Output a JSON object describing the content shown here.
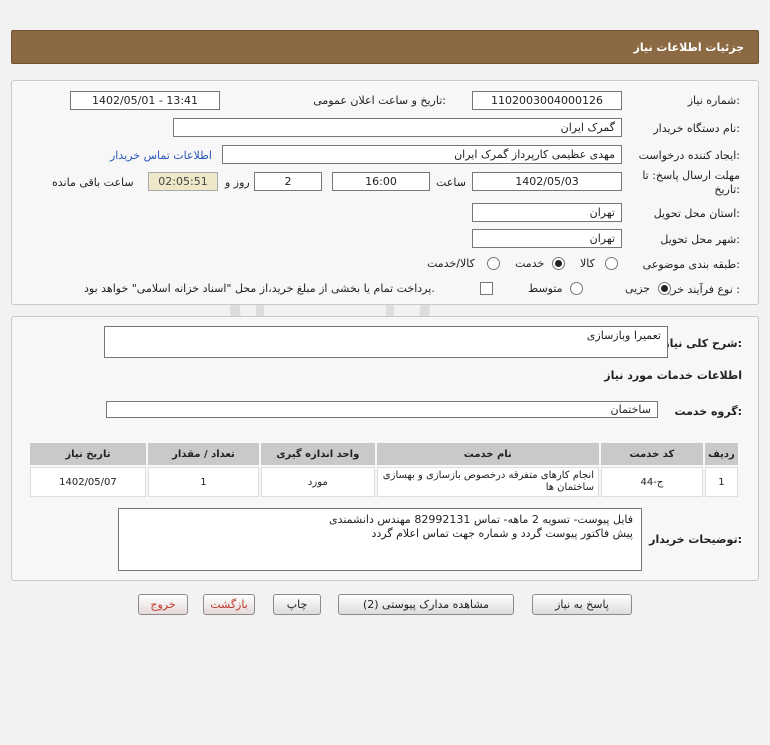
{
  "header": {
    "title": "جزئیات اطلاعات نیاز"
  },
  "form": {
    "need_number_label": "شماره نیاز:",
    "need_number": "1102003004000126",
    "announce_label": "تاریخ و ساعت اعلان عمومی:",
    "announce_value": "1402/05/01 - 13:41",
    "buyer_org_label": "نام دستگاه خریدار:",
    "buyer_org": "گمرک ایران",
    "creator_label": "ایجاد کننده درخواست:",
    "creator": "مهدی عظیمی کارپرداز گمرک ایران",
    "contact_link": "اطلاعات تماس خریدار",
    "deadline_label": "مهلت ارسال پاسخ: تا",
    "deadline_label2": "تاریخ:",
    "deadline_date": "1402/05/03",
    "time_label": "ساعت",
    "deadline_time": "16:00",
    "days_value": "2",
    "days_label": "روز و",
    "remaining_time": "02:05:51",
    "remaining_label": "ساعت باقی مانده",
    "province_label": "استان محل تحویل:",
    "province": "تهران",
    "city_label": "شهر محل تحویل:",
    "city": "تهران",
    "category_label": "طبقه بندی موضوعی:",
    "category_options": [
      "کالا",
      "خدمت",
      "کالا/خدمت"
    ],
    "category_selected": "خدمت",
    "process_label": "نوع فرآیند خرید :",
    "process_options": [
      "جزیی",
      "متوسط"
    ],
    "process_selected": "جزیی",
    "payment_note": "پرداخت تمام یا بخشی از مبلغ خرید،از محل \"اسناد خزانه اسلامی\" خواهد بود."
  },
  "summary": {
    "label": "شرح کلی نیاز:",
    "value": "تعمیرا وبازسازی"
  },
  "services": {
    "section_title": "اطلاعات خدمات مورد نیاز",
    "group_label": "گروه خدمت:",
    "group_value": "ساختمان",
    "columns": [
      "ردیف",
      "کد خدمت",
      "نام خدمت",
      "واحد اندازه گیری",
      "تعداد / مقدار",
      "تاریخ نیاز"
    ],
    "rows": [
      {
        "row": "1",
        "code": "ج-44",
        "name": "انجام کارهای متفرقه درخصوص بازسازی و بهسازی ساختمان ها",
        "unit": "مورد",
        "qty": "1",
        "date": "1402/05/07"
      }
    ]
  },
  "buyer_notes": {
    "label": "توضیحات خریدار:",
    "line1": "فایل پیوست- تسویه 2 ماهه- تماس 82992131 مهندس دانشمندی",
    "line2": "پیش فاکتور پیوست گردد و شماره جهت تماس اعلام گردد"
  },
  "buttons": {
    "reply": "پاسخ به نیاز",
    "attachments": "مشاهده مدارک پیوستی (2)",
    "print": "چاپ",
    "back": "بازگشت",
    "exit": "خروج"
  },
  "colors": {
    "header_bg": "#8b6a43",
    "timer_bg": "#efe8c8",
    "link": "#2a55b8",
    "exit_text": "#c0392b"
  }
}
